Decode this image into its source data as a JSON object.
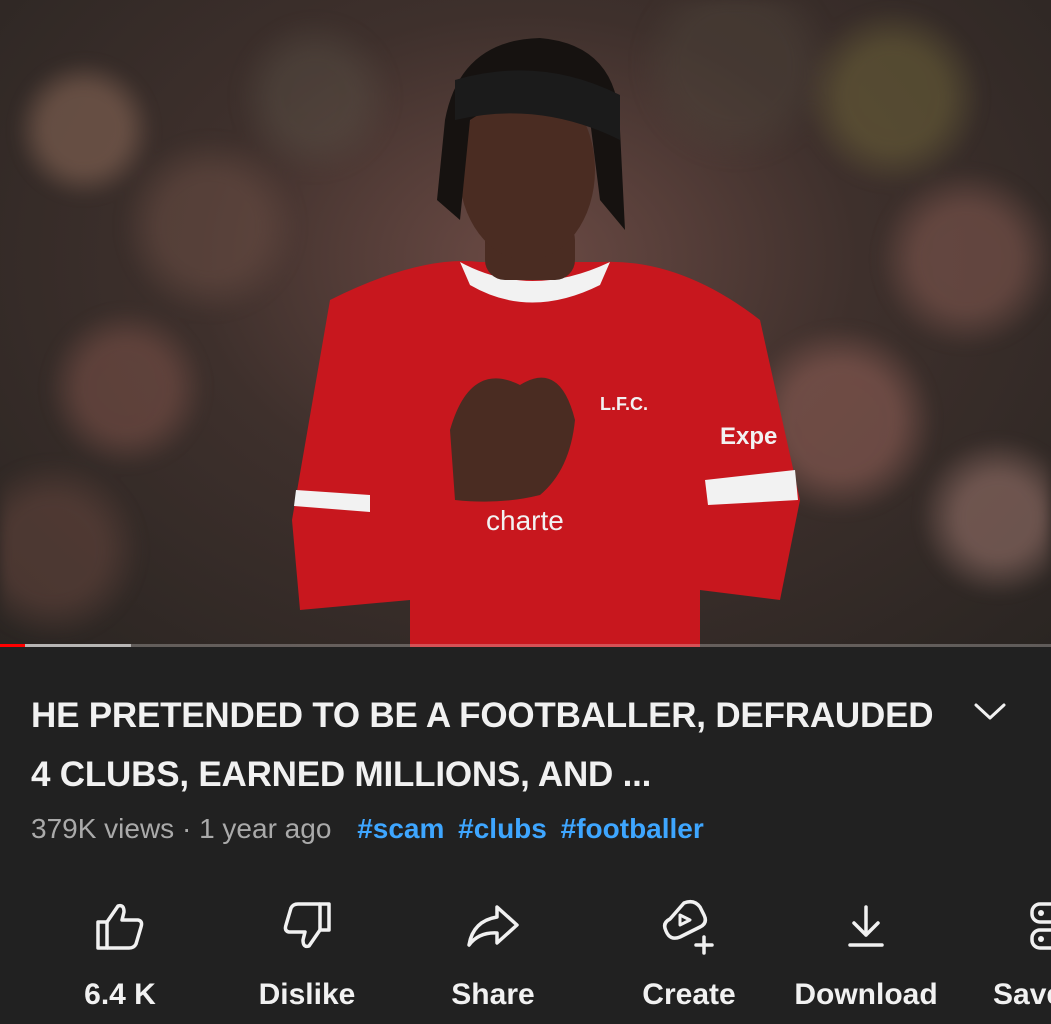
{
  "video": {
    "thumbnail": "Footballer in red Liberpool kit clapping in front of a blurred stadium crowd",
    "progress": {
      "played_fraction": 0.024,
      "buffered_fraction": 0.125
    },
    "colors": {
      "played": "#ff0000",
      "background": "#212121"
    }
  },
  "title": "HE PRETENDED TO BE A FOOTBALLER, DEFRAUDED 4 CLUBS, EARNED MILLIONS, AND ...",
  "meta": {
    "views": "379K views",
    "separator": "·",
    "age": "1 year ago",
    "hashtags": [
      "#scam",
      "#clubs",
      "#footballer"
    ]
  },
  "actions": [
    {
      "icon": "thumbs-up-icon",
      "label": "6.4 K"
    },
    {
      "icon": "thumbs-down-icon",
      "label": "Dislike"
    },
    {
      "icon": "share-icon",
      "label": "Share"
    },
    {
      "icon": "create-icon",
      "label": "Create"
    },
    {
      "icon": "download-icon",
      "label": "Download"
    },
    {
      "icon": "save-icon",
      "label": "Save"
    }
  ],
  "icons": {
    "expand": "chevron-down-icon"
  }
}
